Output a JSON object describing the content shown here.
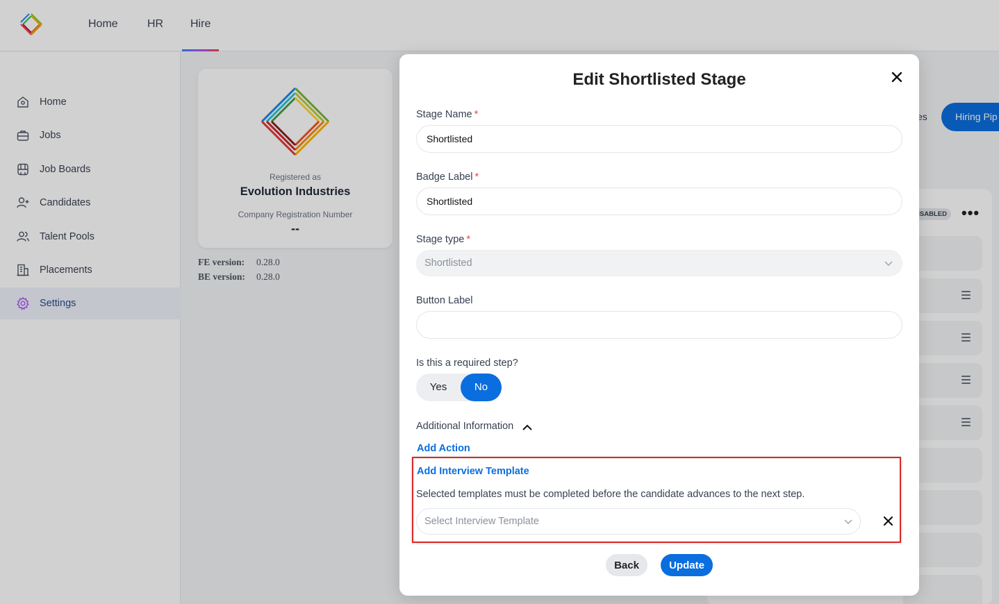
{
  "topnav": {
    "items": [
      {
        "label": "Home"
      },
      {
        "label": "HR"
      },
      {
        "label": "Hire",
        "active": true
      }
    ]
  },
  "sidebar": {
    "items": [
      {
        "label": "Home",
        "icon": "home-icon"
      },
      {
        "label": "Jobs",
        "icon": "briefcase-icon"
      },
      {
        "label": "Job Boards",
        "icon": "job-board-icon"
      },
      {
        "label": "Candidates",
        "icon": "add-user-icon"
      },
      {
        "label": "Talent Pools",
        "icon": "users-icon"
      },
      {
        "label": "Placements",
        "icon": "building-icon"
      },
      {
        "label": "Settings",
        "icon": "gear-icon",
        "active": true
      }
    ]
  },
  "company": {
    "registered_as_label": "Registered as",
    "name": "Evolution Industries",
    "crn_label": "Company Registration Number",
    "crn_value": "--"
  },
  "versions": {
    "fe_label": "FE version:",
    "fe_value": "0.28.0",
    "be_label": "BE version:",
    "be_value": "0.28.0"
  },
  "background": {
    "tab_prev": "es",
    "tab_active": "Hiring Pip",
    "badge": "ISABLED",
    "more": "•••"
  },
  "modal": {
    "title": "Edit Shortlisted Stage",
    "stage_name": {
      "label": "Stage Name",
      "required": "*",
      "value": "Shortlisted"
    },
    "badge_label": {
      "label": "Badge Label",
      "required": "*",
      "value": "Shortlisted"
    },
    "stage_type": {
      "label": "Stage type",
      "required": "*",
      "value": "Shortlisted"
    },
    "button_label": {
      "label": "Button Label",
      "value": ""
    },
    "required_step": {
      "label": "Is this a required step?",
      "yes": "Yes",
      "no": "No",
      "selected": "No"
    },
    "additional_info": "Additional Information",
    "add_action": "Add Action",
    "add_interview_template": "Add Interview Template",
    "template_help": "Selected templates must be completed before the candidate advances to the next step.",
    "template_placeholder": "Select Interview Template",
    "back_button": "Back",
    "update_button": "Update"
  },
  "colors": {
    "primary": "#0a6ede",
    "highlight": "#dc2626",
    "required": "#ef4444"
  }
}
